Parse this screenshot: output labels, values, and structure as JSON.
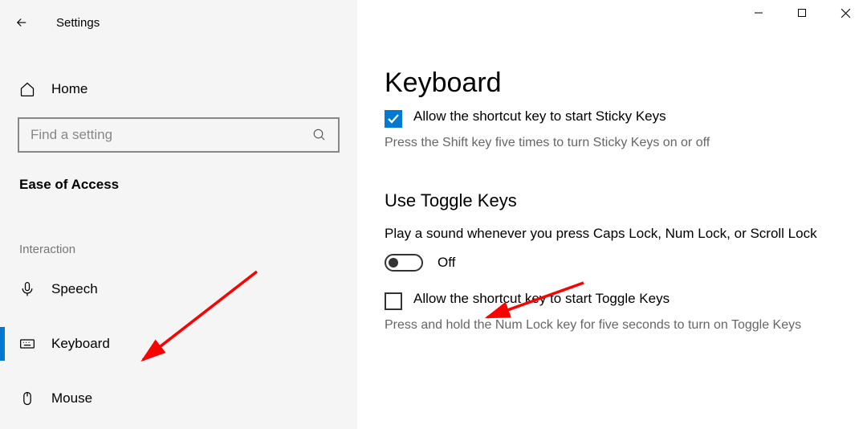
{
  "app_title": "Settings",
  "home_label": "Home",
  "search_placeholder": "Find a setting",
  "category": "Ease of Access",
  "section": "Interaction",
  "nav": [
    {
      "label": "Speech"
    },
    {
      "label": "Keyboard"
    },
    {
      "label": "Mouse"
    }
  ],
  "content": {
    "title": "Keyboard",
    "sticky_check_label": "Allow the shortcut key to start Sticky Keys",
    "sticky_desc": "Press the Shift key five times to turn Sticky Keys on or off",
    "toggle_section": "Use Toggle Keys",
    "toggle_desc": "Play a sound whenever you press Caps Lock, Num Lock, or Scroll Lock",
    "toggle_state": "Off",
    "toggle_check_label": "Allow the shortcut key to start Toggle Keys",
    "toggle_check_desc": "Press and hold the Num Lock key for five seconds to turn on Toggle Keys"
  }
}
